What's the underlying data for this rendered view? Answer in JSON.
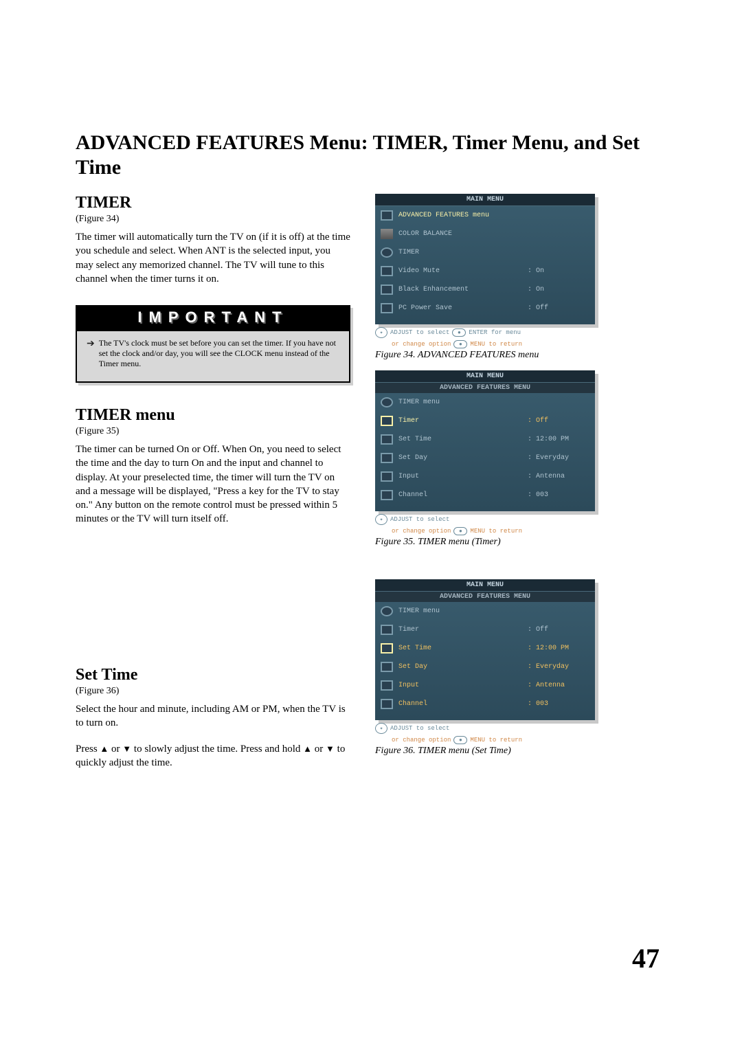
{
  "page": {
    "title": "ADVANCED FEATURES Menu: TIMER, Timer Menu, and Set Time",
    "number": "47"
  },
  "timer": {
    "heading": "TIMER",
    "figref": "(Figure 34)",
    "body": "The timer will automatically turn the TV on (if it is off) at the time you schedule and select.  When ANT is the selected input, you may select any memorized channel.  The TV will tune to this channel when the timer turns it on."
  },
  "important": {
    "title": "IMPORTANT",
    "text": "The TV's clock must be set before you can set the timer.  If you have not set the clock and/or day, you will see the CLOCK menu instead of the Timer menu."
  },
  "timermenu": {
    "heading": "TIMER menu",
    "figref": "(Figure 35)",
    "body": "The timer can be turned On or Off.  When On, you need to select the time and the day to turn On and the input and channel to display.  At your preselected time, the timer will turn the TV on and a message will be displayed, \"Press a key for the TV to stay on.\" Any button on the remote control must be pressed within 5 minutes or the TV will turn itself off."
  },
  "settime": {
    "heading": "Set Time",
    "figref": "(Figure 36)",
    "body1": "Select the hour and minute, including AM or PM, when the TV is to turn on.",
    "body2a": "Press ",
    "body2b": " or  ",
    "body2c": " to slowly adjust the time.  Press and hold ",
    "body2d": " or ",
    "body2e": " to quickly adjust the time."
  },
  "osd34": {
    "title": "MAIN MENU",
    "rows": [
      {
        "icon": "swap",
        "label": "ADVANCED FEATURES menu",
        "value": "",
        "hl": true
      },
      {
        "icon": "bars",
        "label": "COLOR BALANCE",
        "value": ""
      },
      {
        "icon": "clock",
        "label": "TIMER",
        "value": ""
      },
      {
        "icon": "square",
        "label": "Video Mute",
        "value": ": On"
      },
      {
        "icon": "square",
        "label": "Black Enhancement",
        "value": ": On"
      },
      {
        "icon": "square",
        "label": "PC Power Save",
        "value": ": Off"
      }
    ],
    "hint1a": "ADJUST to select",
    "hint1b": "ENTER for menu",
    "hint2a": "or change option",
    "hint2b": "MENU to return",
    "caption": "Figure 34.  ADVANCED FEATURES menu"
  },
  "osd35": {
    "title": "MAIN MENU",
    "subtitle": "ADVANCED FEATURES MENU",
    "rows": [
      {
        "icon": "clock",
        "label": "TIMER menu",
        "value": "",
        "hl": false
      },
      {
        "icon": "square",
        "label": "Timer",
        "value": ": Off",
        "hl": true
      },
      {
        "icon": "square",
        "label": "Set Time",
        "value": ": 12:00 PM"
      },
      {
        "icon": "square",
        "label": "Set Day",
        "value": ": Everyday"
      },
      {
        "icon": "square",
        "label": "Input",
        "value": ": Antenna"
      },
      {
        "icon": "square",
        "label": "Channel",
        "value": ": 003"
      }
    ],
    "hint1": "ADJUST to select",
    "hint2a": "or change option",
    "hint2b": "MENU  to  return",
    "caption": "Figure  35.  TIMER menu (Timer)"
  },
  "osd36": {
    "title": "MAIN MENU",
    "subtitle": "ADVANCED FEATURES MENU",
    "rows": [
      {
        "icon": "clock",
        "label": "TIMER menu",
        "value": "",
        "hl": false
      },
      {
        "icon": "square",
        "label": "Timer",
        "value": ": Off"
      },
      {
        "icon": "sqhi",
        "label": "Set Time",
        "value": ": 12:00 PM",
        "hl": true
      },
      {
        "icon": "square",
        "label": "Set Day",
        "value": ": Everyday"
      },
      {
        "icon": "square",
        "label": "Input",
        "value": ": Antenna"
      },
      {
        "icon": "square",
        "label": "Channel",
        "value": ": 003"
      }
    ],
    "hint1": "ADJUST to select",
    "hint2a": "or change option",
    "hint2b": "MENU to return",
    "caption": "Figure  36.  TIMER menu (Set Time)"
  }
}
